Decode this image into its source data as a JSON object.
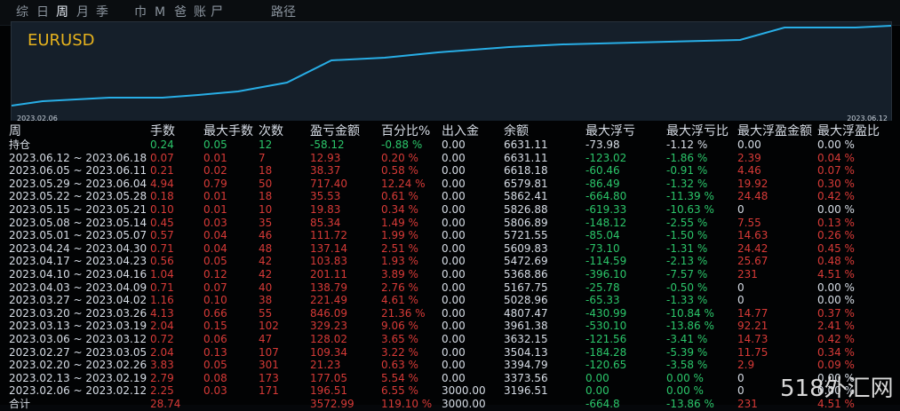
{
  "tabs": [
    "综",
    "日",
    "周",
    "月",
    "季",
    "巾",
    "M",
    "爸",
    "账",
    "尸",
    "路径"
  ],
  "active_tab_index": 2,
  "chart": {
    "symbol": "EURUSD",
    "start_date": "2023.02.06",
    "end_date": "2023.06.12",
    "line_color": "#28aee6"
  },
  "columns": [
    "周",
    "手数",
    "最大手数",
    "次数",
    "盈亏金额",
    "百分比%",
    "出入金",
    "余额",
    "最大浮亏",
    "最大浮亏比",
    "最大浮盈金额",
    "最大浮盈比"
  ],
  "holdings": {
    "label": "持仓",
    "values": [
      "0.24",
      "0.05",
      "12",
      "-58.12",
      "-0.88 %",
      "0.00",
      "6631.11",
      "-73.98",
      "-1.12 %",
      "0.00",
      "0.00 %"
    ]
  },
  "weekly_rows": [
    [
      "2023.06.12 ~ 2023.06.18",
      "0.07",
      "0.01",
      "7",
      "12.93",
      "0.20 %",
      "0.00",
      "6631.11",
      "-123.02",
      "-1.86 %",
      "2.39",
      "0.04 %"
    ],
    [
      "2023.06.05 ~ 2023.06.11",
      "0.21",
      "0.02",
      "18",
      "38.37",
      "0.58 %",
      "0.00",
      "6618.18",
      "-60.46",
      "-0.91 %",
      "4.46",
      "0.07 %"
    ],
    [
      "2023.05.29 ~ 2023.06.04",
      "4.94",
      "0.79",
      "50",
      "717.40",
      "12.24 %",
      "0.00",
      "6579.81",
      "-86.49",
      "-1.32 %",
      "19.92",
      "0.30 %"
    ],
    [
      "2023.05.22 ~ 2023.05.28",
      "0.18",
      "0.01",
      "18",
      "35.53",
      "0.61 %",
      "0.00",
      "5862.41",
      "-664.80",
      "-11.39 %",
      "24.48",
      "0.42 %"
    ],
    [
      "2023.05.15 ~ 2023.05.21",
      "0.10",
      "0.01",
      "10",
      "19.83",
      "0.34 %",
      "0.00",
      "5826.88",
      "-619.33",
      "-10.63 %",
      "0",
      "0.00 %"
    ],
    [
      "2023.05.08 ~ 2023.05.14",
      "0.45",
      "0.03",
      "35",
      "85.34",
      "1.49 %",
      "0.00",
      "5806.89",
      "-148.12",
      "-2.55 %",
      "7.55",
      "0.13 %"
    ],
    [
      "2023.05.01 ~ 2023.05.07",
      "0.57",
      "0.04",
      "46",
      "111.72",
      "1.99 %",
      "0.00",
      "5721.55",
      "-85.04",
      "-1.50 %",
      "14.63",
      "0.26 %"
    ],
    [
      "2023.04.24 ~ 2023.04.30",
      "0.71",
      "0.04",
      "48",
      "137.14",
      "2.51 %",
      "0.00",
      "5609.83",
      "-73.10",
      "-1.31 %",
      "24.42",
      "0.45 %"
    ],
    [
      "2023.04.17 ~ 2023.04.23",
      "0.56",
      "0.05",
      "42",
      "103.83",
      "1.93 %",
      "0.00",
      "5472.69",
      "-114.59",
      "-2.13 %",
      "25.67",
      "0.48 %"
    ],
    [
      "2023.04.10 ~ 2023.04.16",
      "1.04",
      "0.12",
      "42",
      "201.11",
      "3.89 %",
      "0.00",
      "5368.86",
      "-396.10",
      "-7.57 %",
      "231",
      "4.51 %"
    ],
    [
      "2023.04.03 ~ 2023.04.09",
      "0.71",
      "0.07",
      "40",
      "138.79",
      "2.76 %",
      "0.00",
      "5167.75",
      "-25.78",
      "-0.50 %",
      "0",
      "0.00 %"
    ],
    [
      "2023.03.27 ~ 2023.04.02",
      "1.16",
      "0.10",
      "38",
      "221.49",
      "4.61 %",
      "0.00",
      "5028.96",
      "-65.33",
      "-1.33 %",
      "0",
      "0.00 %"
    ],
    [
      "2023.03.20 ~ 2023.03.26",
      "4.13",
      "0.66",
      "55",
      "846.09",
      "21.36 %",
      "0.00",
      "4807.47",
      "-430.99",
      "-10.84 %",
      "14.77",
      "0.37 %"
    ],
    [
      "2023.03.13 ~ 2023.03.19",
      "2.04",
      "0.15",
      "102",
      "329.23",
      "9.06 %",
      "0.00",
      "3961.38",
      "-530.10",
      "-13.86 %",
      "92.21",
      "2.41 %"
    ],
    [
      "2023.03.06 ~ 2023.03.12",
      "0.72",
      "0.06",
      "47",
      "128.02",
      "3.65 %",
      "0.00",
      "3632.15",
      "-121.56",
      "-3.41 %",
      "14.73",
      "0.42 %"
    ],
    [
      "2023.02.27 ~ 2023.03.05",
      "2.04",
      "0.13",
      "107",
      "109.34",
      "3.22 %",
      "0.00",
      "3504.13",
      "-184.28",
      "-5.39 %",
      "11.75",
      "0.34 %"
    ],
    [
      "2023.02.20 ~ 2023.02.26",
      "3.83",
      "0.05",
      "301",
      "21.23",
      "0.63 %",
      "0.00",
      "3394.79",
      "-120.65",
      "-3.58 %",
      "2.9",
      "0.09 %"
    ],
    [
      "2023.02.13 ~ 2023.02.19",
      "2.79",
      "0.08",
      "173",
      "177.05",
      "5.54 %",
      "0.00",
      "3373.56",
      "0.00",
      "0.00 %",
      "0",
      "0.00 %"
    ],
    [
      "2023.02.06 ~ 2023.02.12",
      "2.25",
      "0.03",
      "171",
      "196.51",
      "6.55 %",
      "3000.00",
      "3196.51",
      "0.00",
      "0.00 %",
      "0",
      "0.00 %"
    ]
  ],
  "total": {
    "label": "合计",
    "values": [
      "28.74",
      "",
      "",
      "3572.99",
      "119.10 %",
      "3000.00",
      "",
      "-664.8",
      "-13.86 %",
      "231",
      "4.51 %"
    ]
  },
  "watermark": "518外汇网"
}
